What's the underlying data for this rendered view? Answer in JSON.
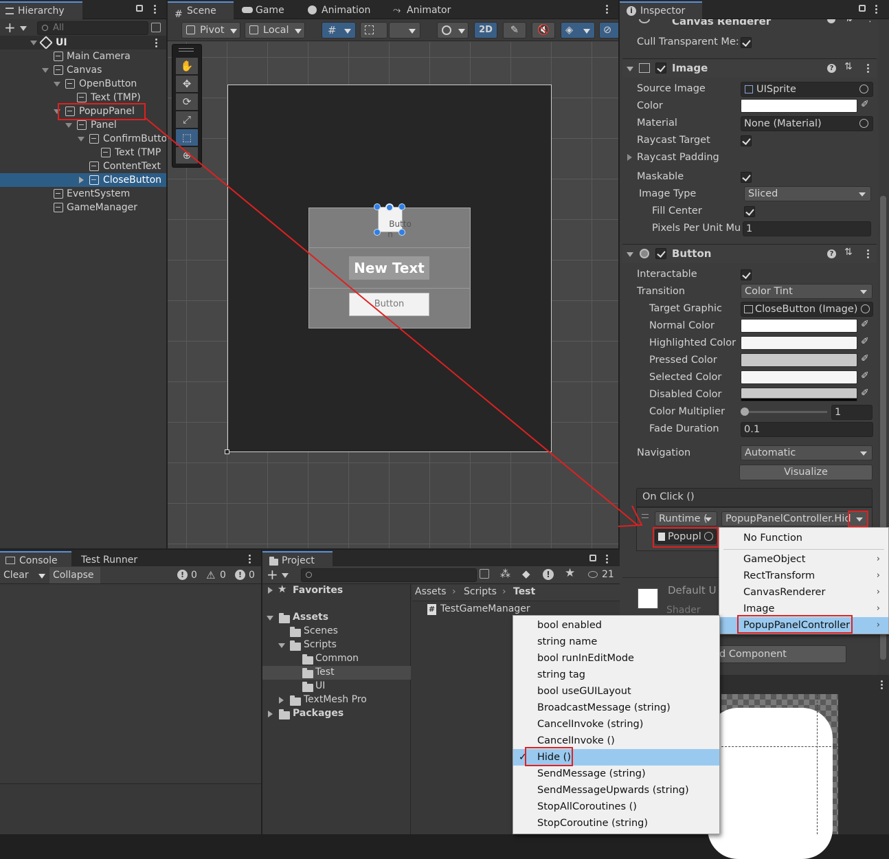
{
  "hierarchy": {
    "tab": "Hierarchy",
    "search_placeholder": "All",
    "scene_root": "UI",
    "items": [
      {
        "label": "Main Camera"
      },
      {
        "label": "Canvas"
      },
      {
        "label": "OpenButton"
      },
      {
        "label": "Text (TMP)"
      },
      {
        "label": "PopupPanel"
      },
      {
        "label": "Panel"
      },
      {
        "label": "ConfirmButto"
      },
      {
        "label": "Text (TMP"
      },
      {
        "label": "ContentText"
      },
      {
        "label": "CloseButton"
      },
      {
        "label": "EventSystem"
      },
      {
        "label": "GameManager"
      }
    ]
  },
  "scene": {
    "tabs": [
      "Scene",
      "Game",
      "Animation",
      "Animator"
    ],
    "pivot": "Pivot",
    "local": "Local",
    "mode_2d": "2D",
    "button_top_text": "Butto\nn",
    "new_text": "New Text",
    "button_text": "Button"
  },
  "inspector": {
    "tab": "Inspector",
    "canvas_renderer": {
      "title": "Canvas Renderer",
      "cull_label": "Cull Transparent Me:"
    },
    "image": {
      "title": "Image",
      "source_image_label": "Source Image",
      "source_image": "UISprite",
      "color_label": "Color",
      "material_label": "Material",
      "material": "None (Material)",
      "raycast_target_label": "Raycast Target",
      "raycast_padding_label": "Raycast Padding",
      "maskable_label": "Maskable",
      "image_type_label": "Image Type",
      "image_type": "Sliced",
      "fill_center_label": "Fill Center",
      "ppu_label": "Pixels Per Unit Mu",
      "ppu": "1"
    },
    "button": {
      "title": "Button",
      "interactable_label": "Interactable",
      "transition_label": "Transition",
      "transition": "Color Tint",
      "target_graphic_label": "Target Graphic",
      "target_graphic": "CloseButton (Image)",
      "normal_label": "Normal Color",
      "highlighted_label": "Highlighted Color",
      "pressed_label": "Pressed Color",
      "selected_label": "Selected Color",
      "disabled_label": "Disabled Color",
      "multiplier_label": "Color Multiplier",
      "multiplier": "1",
      "fade_label": "Fade Duration",
      "fade": "0.1",
      "navigation_label": "Navigation",
      "navigation": "Automatic",
      "visualize": "Visualize"
    },
    "onclick": {
      "title": "On Click ()",
      "runtime": "Runtime (",
      "function": "PopupPanelController.Hid",
      "object": "Popupl"
    },
    "material_preview": {
      "name": "Default U",
      "shader": "Shader"
    },
    "add_component": "d Component"
  },
  "component_menu": {
    "items": [
      "No Function",
      "GameObject",
      "RectTransform",
      "CanvasRenderer",
      "Image",
      "PopupPanelController"
    ]
  },
  "method_menu": {
    "items": [
      "bool enabled",
      "string name",
      "bool runInEditMode",
      "string tag",
      "bool useGUILayout",
      "BroadcastMessage (string)",
      "CancelInvoke (string)",
      "CancelInvoke ()",
      "Hide ()",
      "SendMessage (string)",
      "SendMessageUpwards (string)",
      "StopAllCoroutines ()",
      "StopCoroutine (string)"
    ],
    "selected": "Hide ()"
  },
  "console": {
    "tabs": [
      "Console",
      "Test Runner"
    ],
    "clear": "Clear",
    "collapse": "Collapse",
    "info_count": "0",
    "warn_count": "0",
    "error_count": "0"
  },
  "project": {
    "tab": "Project",
    "favorites": "Favorites",
    "tree": [
      "Assets",
      "Scenes",
      "Scripts",
      "Common",
      "Test",
      "UI",
      "TextMesh Pro",
      "Packages"
    ],
    "breadcrumb": [
      "Assets",
      "Scripts",
      "Test"
    ],
    "file": "TestGameManager",
    "hidden_count": "21"
  }
}
